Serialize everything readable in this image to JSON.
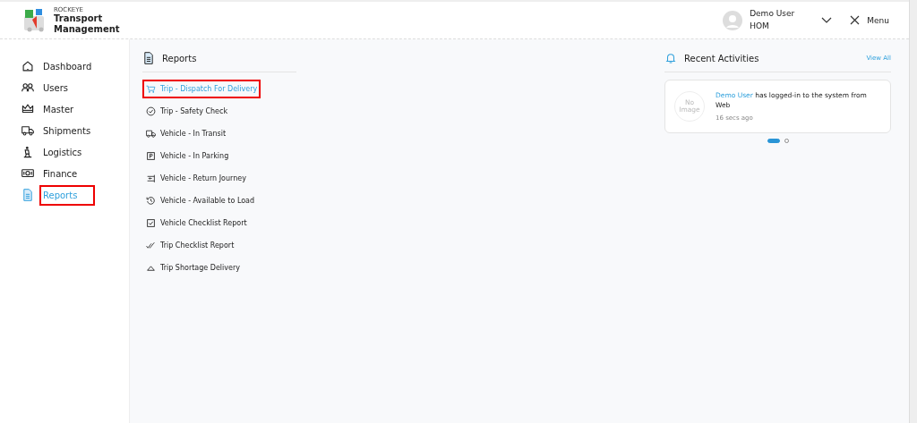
{
  "header": {
    "brand_small": "ROCKEYE",
    "brand_title": "Transport Management",
    "user": {
      "name": "Demo User",
      "role": "HOM"
    },
    "menu_label": "Menu"
  },
  "sidebar": {
    "items": [
      {
        "label": "Dashboard",
        "selected": false,
        "highlighted": false
      },
      {
        "label": "Users",
        "selected": false,
        "highlighted": false
      },
      {
        "label": "Master",
        "selected": false,
        "highlighted": false
      },
      {
        "label": "Shipments",
        "selected": false,
        "highlighted": false
      },
      {
        "label": "Logistics",
        "selected": false,
        "highlighted": false
      },
      {
        "label": "Finance",
        "selected": false,
        "highlighted": false
      },
      {
        "label": "Reports",
        "selected": true,
        "highlighted": true
      }
    ]
  },
  "reports": {
    "title": "Reports",
    "items": [
      {
        "label": "Trip - Dispatch For Delivery",
        "selected": true,
        "highlighted": true
      },
      {
        "label": "Trip - Safety Check",
        "selected": false,
        "highlighted": false
      },
      {
        "label": "Vehicle - In Transit",
        "selected": false,
        "highlighted": false
      },
      {
        "label": "Vehicle - In Parking",
        "selected": false,
        "highlighted": false
      },
      {
        "label": "Vehicle - Return Journey",
        "selected": false,
        "highlighted": false
      },
      {
        "label": "Vehicle - Available to Load",
        "selected": false,
        "highlighted": false
      },
      {
        "label": "Vehicle Checklist Report",
        "selected": false,
        "highlighted": false
      },
      {
        "label": "Trip Checklist Report",
        "selected": false,
        "highlighted": false
      },
      {
        "label": "Trip Shortage Delivery",
        "selected": false,
        "highlighted": false
      }
    ]
  },
  "activities": {
    "title": "Recent Activities",
    "view_all": "View All",
    "items": [
      {
        "avatar_text": "No Image",
        "user": "Demo User",
        "message": "has logged-in to the system from Web",
        "time": "16 secs ago"
      }
    ],
    "pager": [
      {
        "selected": true
      },
      {
        "selected": false
      }
    ]
  }
}
